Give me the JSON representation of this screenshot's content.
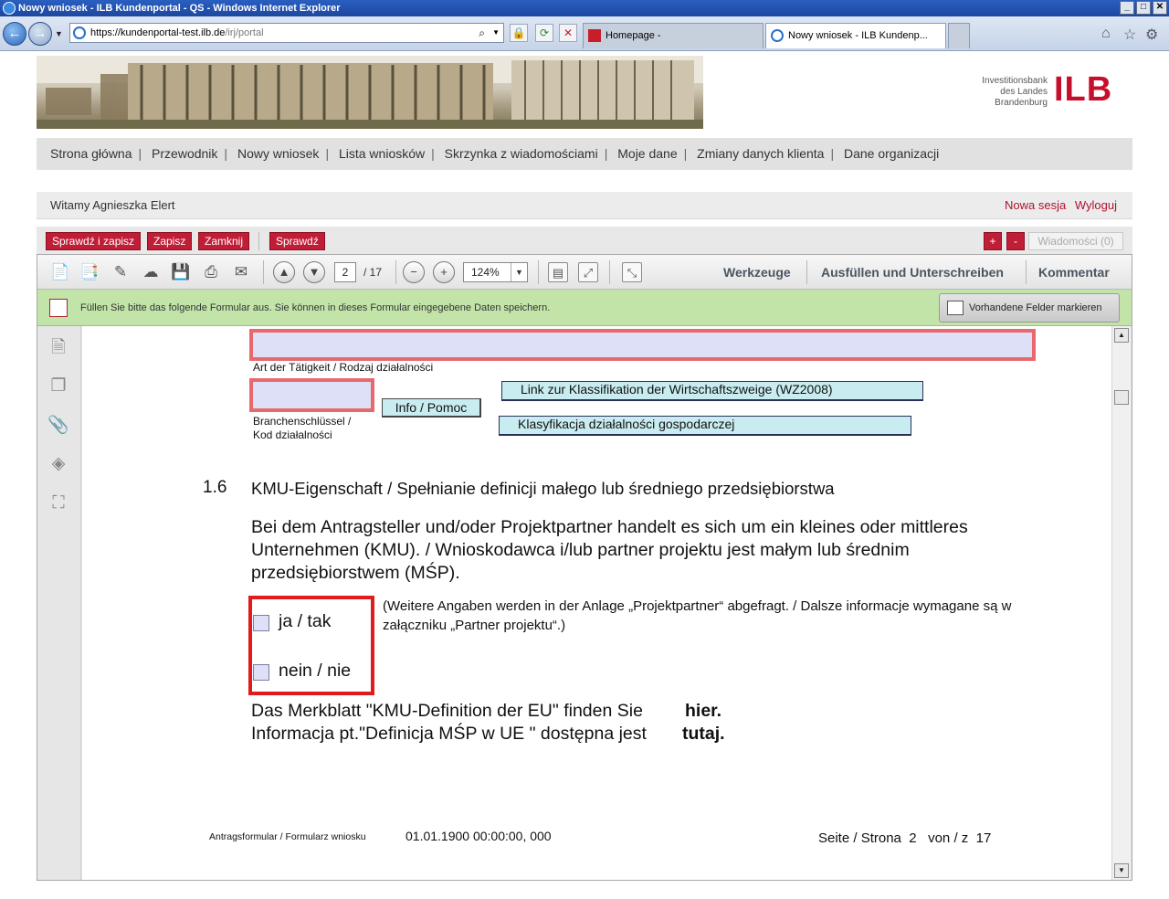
{
  "window": {
    "title": "Nowy wniosek - ILB Kundenportal - QS - Windows Internet Explorer",
    "url_host": "https://kundenportal-test.ilb.de",
    "url_path": "/irj/portal",
    "tabs": [
      {
        "label": "Homepage -",
        "active": false
      },
      {
        "label": "Nowy wniosek - ILB Kundenp...",
        "active": true
      }
    ]
  },
  "logo": {
    "line1": "Investitionsbank",
    "line2": "des Landes",
    "line3": "Brandenburg",
    "mark": "ILB",
    "color": "#c6102b"
  },
  "nav": {
    "items": [
      "Strona główna",
      "Przewodnik",
      "Nowy wniosek",
      "Lista wniosków",
      "Skrzynka z wiadomościami",
      "Moje dane",
      "Zmiany danych klienta",
      "Dane organizacji"
    ],
    "separator": "|"
  },
  "welcome": {
    "text": "Witamy Agnieszka Elert",
    "new_session": "Nowa sesja",
    "logout": "Wyloguj"
  },
  "actions": {
    "check_save": "Sprawdź i zapisz",
    "save": "Zapisz",
    "close": "Zamknij",
    "check": "Sprawdź",
    "plus": "+",
    "minus": "-",
    "messages": "Wiadomości (0)",
    "accent": "#c01e37"
  },
  "pdf_toolbar": {
    "page_current": "2",
    "page_total": "/ 17",
    "zoom": "124%",
    "tools": "Werkzeuge",
    "fill_sign": "Ausfüllen und Unterschreiben",
    "comment": "Kommentar"
  },
  "infobar": {
    "text": "Füllen Sie bitte das folgende Formular aus. Sie können in dieses Formular eingegebene Daten speichern.",
    "button": "Vorhandene Felder markieren",
    "color": "#c3e4a9"
  },
  "form": {
    "activity_label": "Art der Tätigkeit / Rodzaj działalności",
    "branch_label_1": "Branchenschlüssel /",
    "branch_label_2": "Kod działalności",
    "info_button": "Info / Pomoc",
    "link_wz": "Link zur Klassifikation der Wirtschaftszweige (WZ2008)",
    "link_pl": "Klasyfikacja działalności gospodarczej",
    "section_number": "1.6",
    "section_title": "KMU-Eigenschaft / Spełnianie definicji małego lub średniego przedsiębiorstwa",
    "section_text": "Bei dem Antragsteller und/oder Projektpartner handelt es sich um ein kleines oder mittleres Unternehmen (KMU). / Wnioskodawca i/lub partner projektu jest małym lub średnim przedsiębiorstwem (MŚP).",
    "option_yes": "ja / tak",
    "option_no": "nein / nie",
    "note": "(Weitere Angaben werden in der Anlage „Projektpartner“ abgefragt. / Dalsze informacje wymagane są w załączniku „Partner projektu“.)",
    "merkblatt_de": "Das Merkblatt \"KMU-Definition der EU\" finden Sie",
    "merkblatt_de_link": "hier.",
    "merkblatt_pl": "Informacja pt.\"Definicja MŚP w UE \" dostępna jest",
    "merkblatt_pl_link": "tutaj.",
    "footer_form": "Antragsformular / Formularz wniosku",
    "footer_date": "01.01.1900 00:00:00, 000",
    "footer_page_label": "Seite / Strona",
    "footer_page": "2",
    "footer_of": "von / z",
    "footer_total": "17"
  }
}
